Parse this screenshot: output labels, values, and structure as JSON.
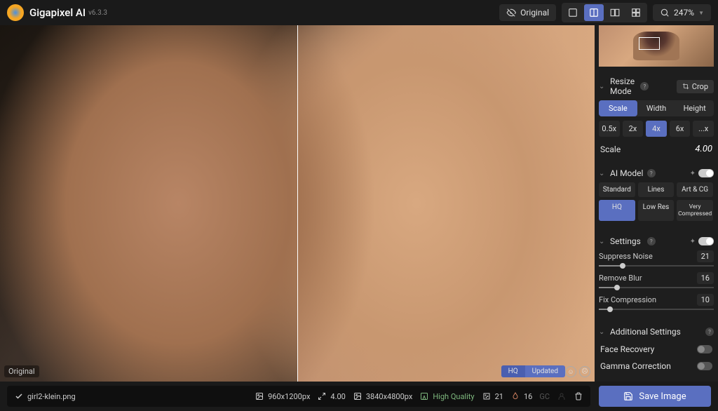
{
  "app": {
    "title": "Gigapixel AI",
    "version": "v6.3.3"
  },
  "header": {
    "original_label": "Original",
    "zoom": "247%"
  },
  "viewer": {
    "original_label": "Original",
    "badge_left": "HQ",
    "badge_right": "Updated"
  },
  "resize": {
    "title": "Resize Mode",
    "crop_label": "Crop",
    "tabs": [
      "Scale",
      "Width",
      "Height"
    ],
    "active_tab": "Scale",
    "presets": [
      "0.5x",
      "2x",
      "4x",
      "6x",
      "...x"
    ],
    "active_preset": "4x",
    "scale_label": "Scale",
    "scale_value": "4.00"
  },
  "ai_model": {
    "title": "AI Model",
    "options": [
      "Standard",
      "Lines",
      "Art & CG",
      "HQ",
      "Low Res",
      "Very Compressed"
    ],
    "active": "HQ"
  },
  "settings": {
    "title": "Settings",
    "sliders": [
      {
        "label": "Suppress Noise",
        "value": 21,
        "pct": 21
      },
      {
        "label": "Remove Blur",
        "value": 16,
        "pct": 16
      },
      {
        "label": "Fix Compression",
        "value": 10,
        "pct": 10
      }
    ]
  },
  "additional": {
    "title": "Additional Settings",
    "toggles": [
      {
        "label": "Face Recovery",
        "on": false
      },
      {
        "label": "Gamma Correction",
        "on": false
      }
    ]
  },
  "footer": {
    "filename": "girl2-klein.png",
    "source_dims": "960x1200px",
    "scale": "4.00",
    "output_dims": "3840x4800px",
    "quality_label": "High Quality",
    "noise_val": "21",
    "blur_val": "16",
    "gc_label": "GC",
    "save_label": "Save Image"
  }
}
